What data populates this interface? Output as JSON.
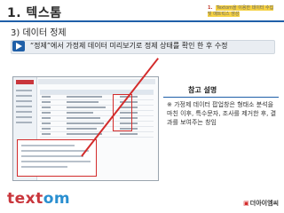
{
  "slide": {
    "title": "1. 텍스톰",
    "subtitle": "3) 데이터 정제",
    "banner_text": "“정제”에서 가정제 데이터 미리보기로 정제 상태를 확인 한 후 수정",
    "top_note": {
      "number": "1.",
      "text": "Textom을 이용한 데이터 수집 및 매트릭스 생성"
    },
    "reference": {
      "title": "참고 설명",
      "text": "※ 가정제 데이터 팝업창은 형태소 분석을 마친 이후, 특수문자, 조사를 제거한 후, 결과를 보여주는 창임"
    },
    "footer": {
      "logo_a": "text",
      "logo_b": "om",
      "brand_mark": "▣",
      "brand_text": "더아이엠씨"
    }
  },
  "colors": {
    "accent_blue": "#1f5fa8",
    "highlight_red": "#d32b2b",
    "logo_red": "#c9363c",
    "logo_blue": "#2a8fd0"
  }
}
